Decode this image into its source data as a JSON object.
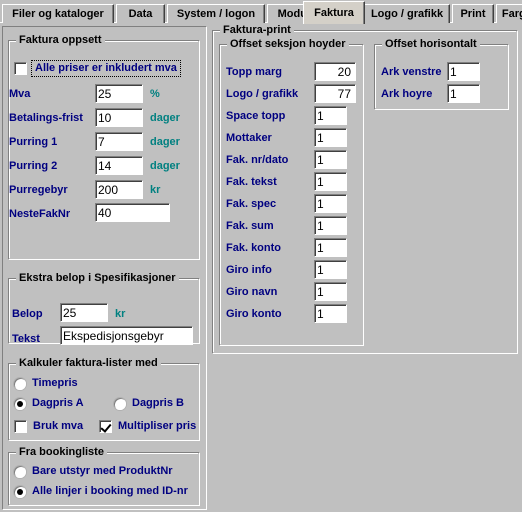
{
  "tabs": [
    {
      "label": "Filer og kataloger",
      "selected": false
    },
    {
      "label": "Data",
      "selected": false
    },
    {
      "label": "System / logon",
      "selected": false
    },
    {
      "label": "Moduler",
      "selected": false
    },
    {
      "label": "Faktura",
      "selected": true
    },
    {
      "label": "Logo / grafikk",
      "selected": false
    },
    {
      "label": "Print",
      "selected": false
    },
    {
      "label": "Farger",
      "selected": false
    }
  ],
  "faktura_oppsett": {
    "title": "Faktura oppsett",
    "include_vat": {
      "label": "Alle priser er inkludert mva",
      "checked": false
    },
    "fields": [
      {
        "label": "Mva",
        "value": "25",
        "unit": "%"
      },
      {
        "label": "Betalings-frist",
        "value": "10",
        "unit": "dager"
      },
      {
        "label": "Purring 1",
        "value": "7",
        "unit": "dager"
      },
      {
        "label": "Purring 2",
        "value": "14",
        "unit": "dager"
      },
      {
        "label": "Purregebyr",
        "value": "200",
        "unit": "kr"
      },
      {
        "label": "NesteFakNr",
        "value": "40",
        "unit": ""
      }
    ]
  },
  "ekstra_belop": {
    "title": "Ekstra belop i Spesifikasjoner",
    "belop_label": "Belop",
    "belop_value": "25",
    "belop_unit": "kr",
    "tekst_label": "Tekst",
    "tekst_value": "Ekspedisjonsgebyr"
  },
  "kalkuler": {
    "title": "Kalkuler faktura-lister med",
    "options": [
      {
        "label": "Timepris",
        "selected": false
      },
      {
        "label": "Dagpris A",
        "selected": true
      },
      {
        "label": "Dagpris B",
        "selected": false
      }
    ],
    "bruk_mva": {
      "label": "Bruk mva",
      "checked": false
    },
    "multipliser": {
      "label": "Multipliser pris",
      "checked": true
    }
  },
  "bookingliste": {
    "title": "Fra bookingliste",
    "options": [
      {
        "label": "Bare utstyr med ProduktNr",
        "selected": false
      },
      {
        "label": "Alle linjer i booking med ID-nr",
        "selected": true
      }
    ]
  },
  "faktura_print": {
    "title": "Faktura-print",
    "offset_seksjon": {
      "title": "Offset seksjon hoyder",
      "rows": [
        {
          "label": "Topp marg",
          "value": "20",
          "align": "right"
        },
        {
          "label": "Logo / grafikk",
          "value": "77",
          "align": "right"
        },
        {
          "label": "Space topp",
          "value": "1",
          "align": "left"
        },
        {
          "label": "Mottaker",
          "value": "1",
          "align": "left"
        },
        {
          "label": "Fak. nr/dato",
          "value": "1",
          "align": "left"
        },
        {
          "label": "Fak. tekst",
          "value": "1",
          "align": "left"
        },
        {
          "label": "Fak. spec",
          "value": "1",
          "align": "left"
        },
        {
          "label": "Fak. sum",
          "value": "1",
          "align": "left"
        },
        {
          "label": "Fak. konto",
          "value": "1",
          "align": "left"
        },
        {
          "label": "Giro info",
          "value": "1",
          "align": "left"
        },
        {
          "label": "Giro navn",
          "value": "1",
          "align": "left"
        },
        {
          "label": "Giro konto",
          "value": "1",
          "align": "left"
        }
      ]
    },
    "offset_horisontalt": {
      "title": "Offset horisontalt",
      "rows": [
        {
          "label": "Ark venstre",
          "value": "1"
        },
        {
          "label": "Ark hoyre",
          "value": "1"
        }
      ]
    }
  },
  "colors": {
    "background": "#c0c0c0",
    "label": "#000080",
    "unit": "#008080",
    "field_bg": "#ffffff",
    "selected_tab": "#d4d0c8"
  }
}
